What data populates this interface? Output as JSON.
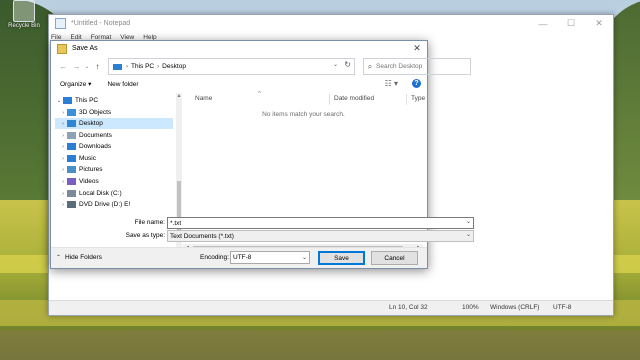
{
  "desktop": {
    "icons": [
      {
        "label": "Recycle Bin",
        "icon": "recycle-bin-icon"
      }
    ]
  },
  "notepad": {
    "title": "*Untitled - Notepad",
    "window_controls": {
      "minimize": "—",
      "maximize": "☐",
      "close": "✕"
    },
    "menu": [
      "File",
      "Edit",
      "Format",
      "View",
      "Help"
    ],
    "status": {
      "position": "Ln 10, Col 32",
      "zoom": "100%",
      "line_ending": "Windows (CRLF)",
      "encoding": "UTF-8"
    }
  },
  "dialog": {
    "title": "Save As",
    "close": "✕",
    "nav": {
      "back": "←",
      "forward": "→",
      "recent": "⌄",
      "up": "↑"
    },
    "breadcrumb": [
      "This PC",
      "Desktop"
    ],
    "search_placeholder": "Search Desktop",
    "toolbar": {
      "organize": "Organize ▾",
      "new_folder": "New folder"
    },
    "tree": [
      {
        "label": "This PC",
        "icon": "computer-icon",
        "color": "#2a7fd4",
        "arrow": "⌄",
        "selected": false,
        "indent": 0
      },
      {
        "label": "3D Objects",
        "icon": "3d-objects-icon",
        "color": "#3c8fd8",
        "arrow": "›",
        "selected": false,
        "indent": 1
      },
      {
        "label": "Desktop",
        "icon": "desktop-folder-icon",
        "color": "#2f86d6",
        "arrow": "›",
        "selected": true,
        "indent": 1
      },
      {
        "label": "Documents",
        "icon": "documents-icon",
        "color": "#8da2b5",
        "arrow": "›",
        "selected": false,
        "indent": 1
      },
      {
        "label": "Downloads",
        "icon": "downloads-icon",
        "color": "#2a7fd4",
        "arrow": "›",
        "selected": false,
        "indent": 1
      },
      {
        "label": "Music",
        "icon": "music-icon",
        "color": "#2a7fd4",
        "arrow": "›",
        "selected": false,
        "indent": 1
      },
      {
        "label": "Pictures",
        "icon": "pictures-icon",
        "color": "#4a90c8",
        "arrow": "›",
        "selected": false,
        "indent": 1
      },
      {
        "label": "Videos",
        "icon": "videos-icon",
        "color": "#7a5fc2",
        "arrow": "›",
        "selected": false,
        "indent": 1
      },
      {
        "label": "Local Disk (C:)",
        "icon": "local-disk-icon",
        "color": "#7a8a99",
        "arrow": "›",
        "selected": false,
        "indent": 1
      },
      {
        "label": "DVD Drive (D:) E!",
        "icon": "dvd-drive-icon",
        "color": "#5d6c79",
        "arrow": "›",
        "selected": false,
        "indent": 1
      }
    ],
    "columns": [
      "Name",
      "Date modified",
      "Type"
    ],
    "empty_message": "No items match your search.",
    "file_name_label": "File name:",
    "file_name_value": "*.txt",
    "save_type_label": "Save as type:",
    "save_type_value": "Text Documents (*.txt)",
    "hide_folders": "Hide Folders",
    "encoding_label": "Encoding:",
    "encoding_value": "UTF-8",
    "save_button": "Save",
    "cancel_button": "Cancel"
  }
}
